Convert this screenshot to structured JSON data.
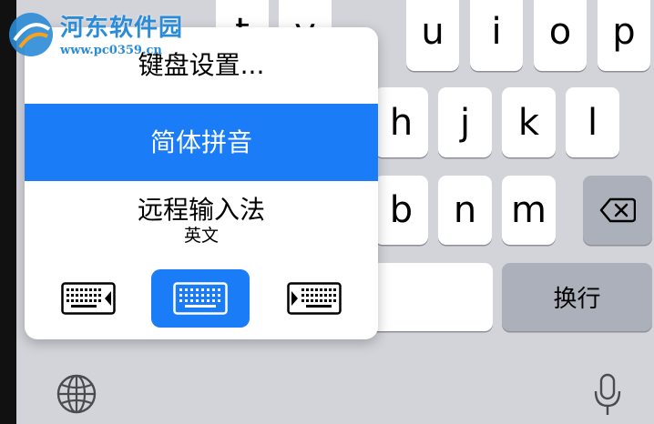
{
  "watermark": {
    "site_name": "河东软件园",
    "url": "www.pc0359.cn"
  },
  "keyboard": {
    "row1_visible": [
      "t",
      "y",
      "u",
      "i",
      "o",
      "p"
    ],
    "row2_visible": [
      "h",
      "j",
      "k",
      "l"
    ],
    "row3_visible": [
      "b",
      "n",
      "m"
    ],
    "return_label": "换行",
    "accent_color": "#1a7cf7"
  },
  "menu": {
    "items": [
      {
        "label": "键盘设置..."
      },
      {
        "label": "简体拼音",
        "selected": true
      },
      {
        "label": "远程输入法",
        "sublabel": "英文"
      }
    ],
    "layout_options": [
      "left-keyboard",
      "full-keyboard",
      "right-keyboard"
    ],
    "active_layout": "full-keyboard"
  },
  "icons": {
    "backspace": "backspace-icon",
    "globe": "globe-icon",
    "microphone": "microphone-icon"
  }
}
